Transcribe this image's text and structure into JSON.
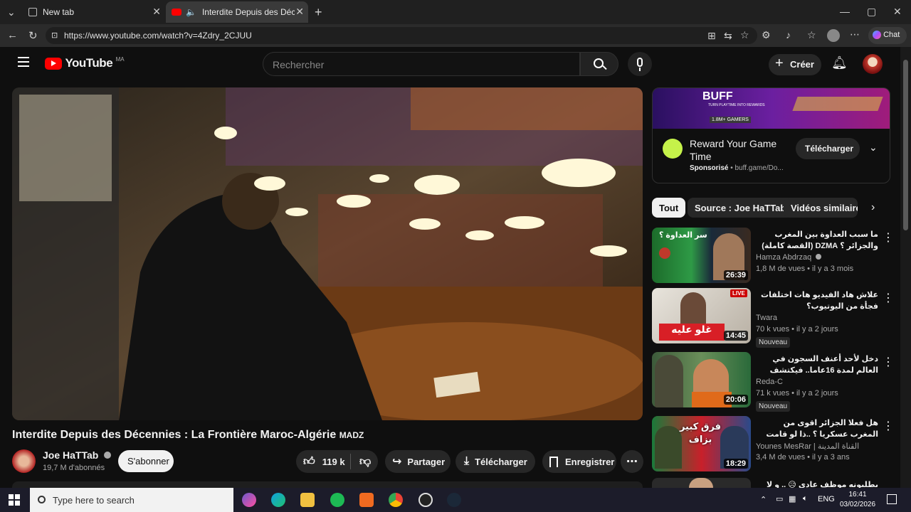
{
  "browser": {
    "tabs": [
      {
        "title": "New tab"
      },
      {
        "title": "Interdite Depuis des Décennies"
      }
    ],
    "url": "https://www.youtube.com/watch?v=4Zdry_2CJUU",
    "chat_label": "Chat"
  },
  "youtube": {
    "logo_text": "YouTube",
    "region": "MA",
    "search_placeholder": "Rechercher",
    "create_label": "Créer"
  },
  "video": {
    "title": "Interdite Depuis des Décennies : La Frontière Maroc-Algérie",
    "title_tag": "MADZ",
    "channel": "Joe HaTTab",
    "subscribers": "19,7 M d'abonnés",
    "subscribe_label": "S'abonner",
    "likes": "119 k",
    "share_label": "Partager",
    "download_label": "Télécharger",
    "save_label": "Enregistrer"
  },
  "ad": {
    "banner_brand": "BUFF",
    "banner_tagline": "TURN PLAYTIME INTO REWARDS",
    "banner_count": "1.8M+ GAMERS",
    "title": "Reward Your Game Time",
    "sponsored": "Sponsorisé",
    "domain": "buff.game/Do...",
    "cta": "Télécharger"
  },
  "chips": [
    "Tout",
    "Source : Joe HaTTab",
    "Vidéos similaires"
  ],
  "recommendations": [
    {
      "title": "ما سبب العداوة بين المغرب والجزائر ؟ DZMA (القصة كاملة)",
      "channel": "Hamza Abdrzaq",
      "meta": "1,8 M de vues • il y a 3 mois",
      "duration": "26:39",
      "thumb_text": "سر العداوة ؟",
      "badge": ""
    },
    {
      "title": "علاش هاد الفيديو هات اختلفات فجأة من اليوتيوب؟",
      "channel": "Twara",
      "meta": "70 k vues • il y a 2 jours",
      "duration": "14:45",
      "thumb_text": "غلو عليه",
      "badge": "Nouveau",
      "live": "LIVE"
    },
    {
      "title": "دخل لأحد أعنف السجون في العالم لمدة 16عاما.. فيكتشف فالأخير أنه كان مظلوما",
      "channel": "Reda-C",
      "meta": "71 k vues • il y a 2 jours",
      "duration": "20:06",
      "thumb_text": "",
      "badge": "Nouveau"
    },
    {
      "title": "هل فعلا الجزائر اقوى من المغرب عسكريا ؟ ..ذا لو قامت الحرب بين المغرب و الجزائر؟",
      "channel": "Younes MesRar | القناة المدينة",
      "meta": "3,4 M de vues • il y a 3 ans",
      "duration": "18:29",
      "thumb_text": "فرق كبير بزاف",
      "badge": ""
    },
    {
      "title": "يطلبونه موظف عادي 😥 .. و لا بغي فين أنه",
      "channel": "",
      "meta": "",
      "duration": "",
      "thumb_text": "",
      "badge": ""
    }
  ],
  "taskbar": {
    "search_placeholder": "Type here to search",
    "lang": "ENG",
    "time": "16:41",
    "date": "03/02/2026"
  },
  "colors": {
    "accent_red": "#ff0000",
    "bg": "#0f0f0f",
    "chip_active": "#f1f1f1"
  }
}
